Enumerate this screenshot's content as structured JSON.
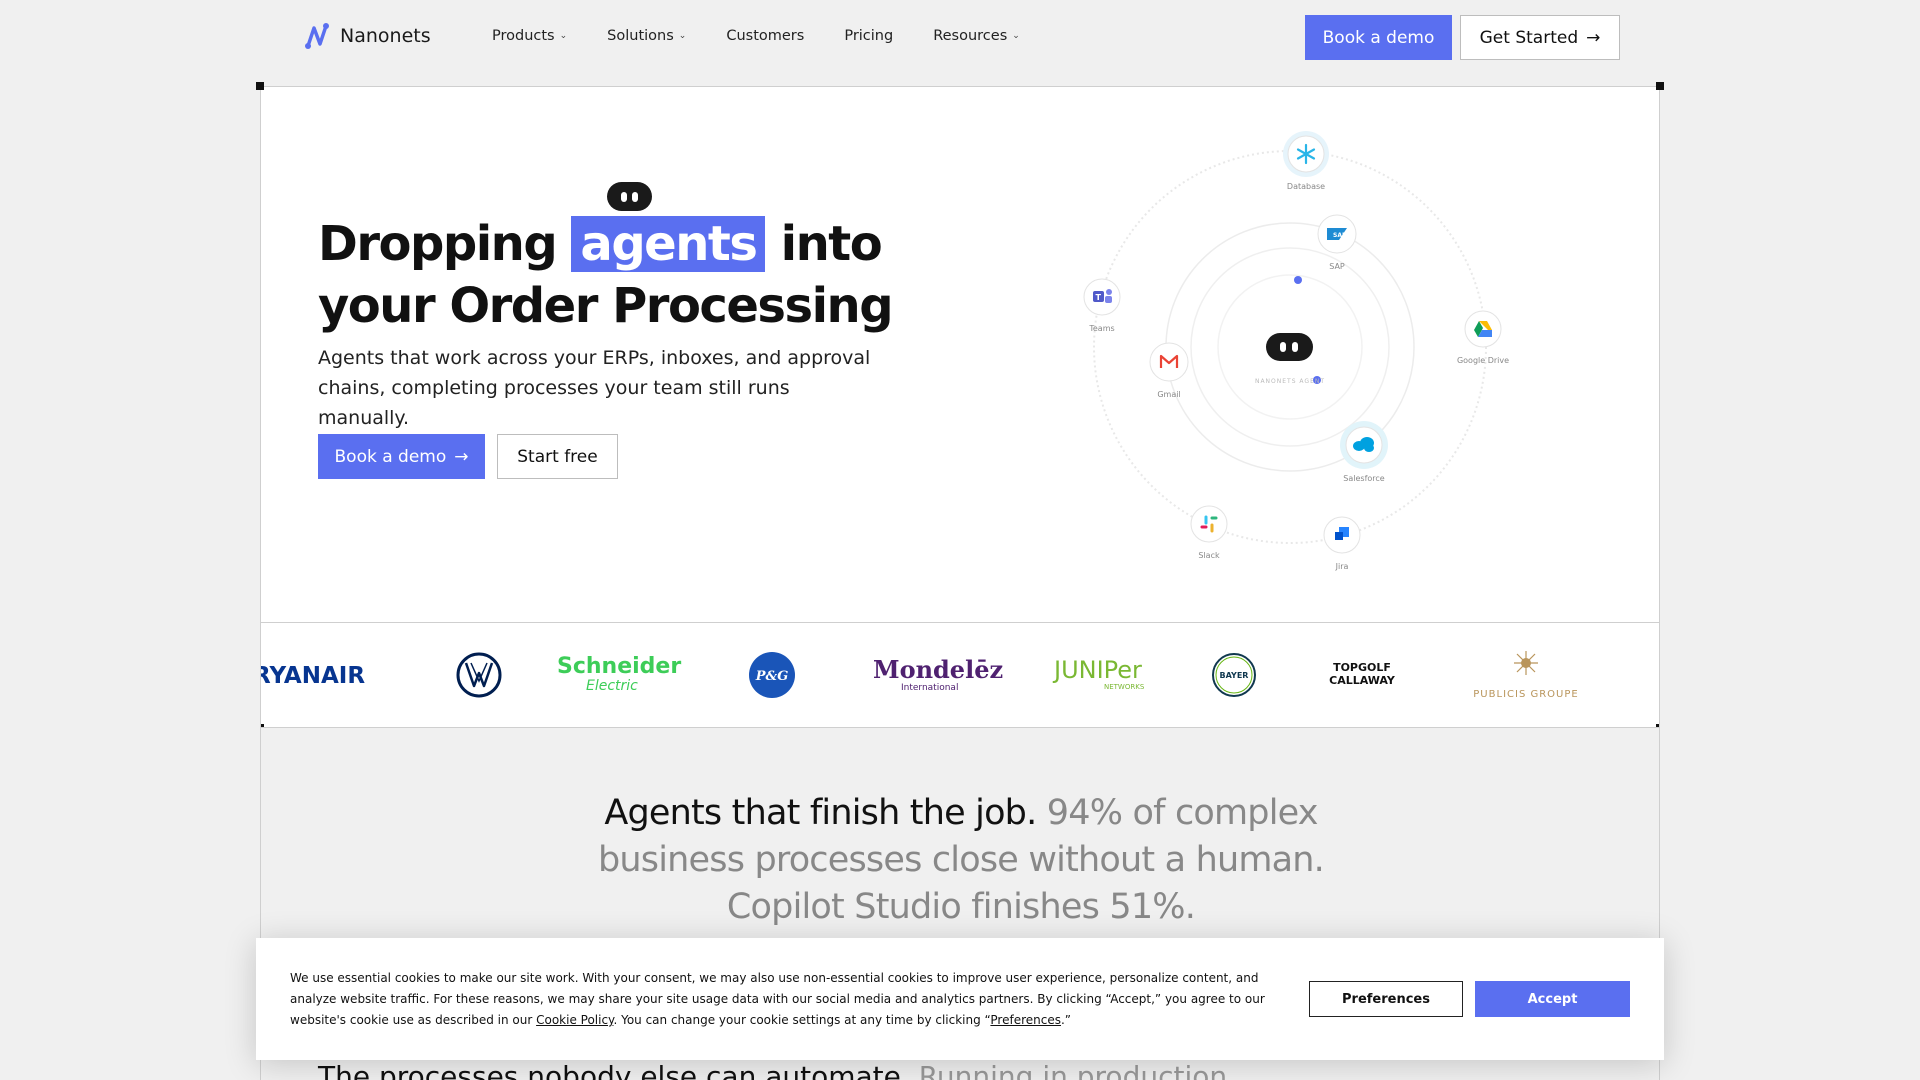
{
  "nav": {
    "brand": "Nanonets",
    "menu": [
      {
        "label": "Products",
        "dropdown": true
      },
      {
        "label": "Solutions",
        "dropdown": true
      },
      {
        "label": "Customers",
        "dropdown": false
      },
      {
        "label": "Pricing",
        "dropdown": false
      },
      {
        "label": "Resources",
        "dropdown": true
      }
    ],
    "book_demo": "Book a demo",
    "get_started": "Get Started",
    "arrow": "→"
  },
  "hero": {
    "title_pre": "Dropping",
    "title_highlight": "agents",
    "title_post": "into your Order Processing",
    "subtitle": "Agents that work across your ERPs, inboxes, and approval chains, completing processes your team still runs manually.",
    "cta_primary": "Book a demo",
    "cta_secondary": "Start free",
    "center_label": "NANONETS AGENT"
  },
  "orbit": {
    "nodes": [
      {
        "name": "Database",
        "icon": "snowflake-icon"
      },
      {
        "name": "SAP",
        "icon": "sap-icon"
      },
      {
        "name": "Teams",
        "icon": "teams-icon"
      },
      {
        "name": "Google Drive",
        "icon": "google-drive-icon"
      },
      {
        "name": "Gmail",
        "icon": "gmail-icon"
      },
      {
        "name": "Salesforce",
        "icon": "salesforce-icon"
      },
      {
        "name": "Slack",
        "icon": "slack-icon"
      },
      {
        "name": "Jira",
        "icon": "jira-icon"
      }
    ]
  },
  "logos": {
    "ryanair": "RYANAIR",
    "vw": "VW",
    "schneider_1": "Schneider",
    "schneider_2": "Electric",
    "pg": "P&G",
    "mondelez_1": "Mondelēz",
    "mondelez_2": "International",
    "juniper_1": "JUNIPer",
    "juniper_2": "NETWORKS",
    "bayer": "BAYER",
    "topgolf_1": "TOPGOLF",
    "topgolf_2": "CALLAWAY",
    "publicis": "PUBLICIS GROUPE"
  },
  "section": {
    "statement_dark": "Agents that finish the job.",
    "statement_light": "94% of complex business processes close without a human. Copilot Studio finishes 51%.",
    "peek_dark": "The processes nobody else can automate.",
    "peek_light": "Running in production."
  },
  "cookie": {
    "text_1": "We use essential cookies to make our site work. With your consent, we may also use non-essential cookies to improve user experience, personalize content, and analyze website traffic. For these reasons, we may share your site usage data with our social media and analytics partners. By clicking “Accept,” you agree to our website's cookie use as described in our ",
    "policy_link": "Cookie Policy",
    "text_2": ". You can change your cookie settings at any time by clicking “",
    "pref_link": "Preferences",
    "text_3": ".”",
    "preferences_button": "Preferences",
    "accept_button": "Accept"
  },
  "colors": {
    "accent": "#5a6ff0",
    "background": "#f0f0f0",
    "dark": "#1a1a1a"
  }
}
